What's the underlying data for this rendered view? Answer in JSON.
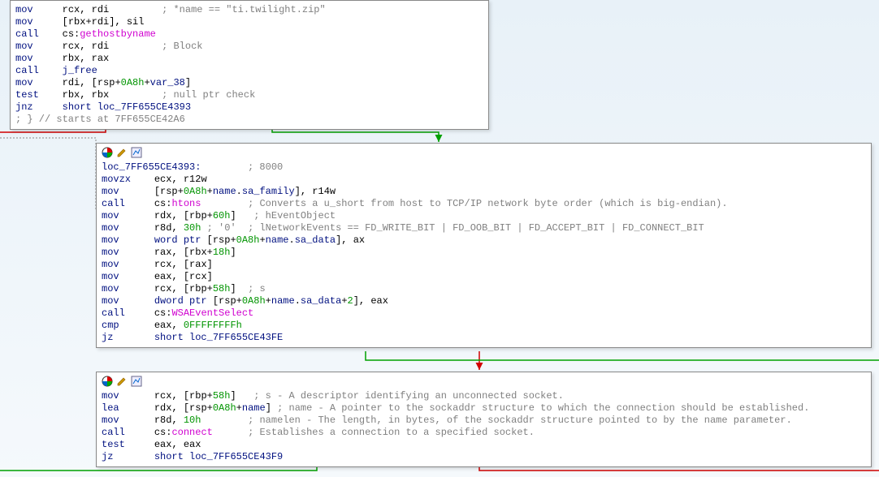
{
  "box1": {
    "lines": [
      {
        "p": [
          [
            "mnem",
            "mov   "
          ],
          [
            "reg",
            "  rcx"
          ],
          [
            "dot",
            ", "
          ],
          [
            "reg",
            "rdi         "
          ],
          [
            "comment",
            "; *name == \"ti.twilight.zip\""
          ]
        ]
      },
      {
        "p": [
          [
            "mnem",
            "mov   "
          ],
          [
            "dot",
            "  ["
          ],
          [
            "reg",
            "rbx"
          ],
          [
            "dot",
            "+"
          ],
          [
            "reg",
            "rdi"
          ],
          [
            "dot",
            "], "
          ],
          [
            "reg",
            "sil"
          ]
        ]
      },
      {
        "p": [
          [
            "mnem",
            "call  "
          ],
          [
            "dot",
            "  cs:"
          ],
          [
            "apicall",
            "gethostbyname"
          ]
        ]
      },
      {
        "p": [
          [
            "mnem",
            "mov   "
          ],
          [
            "reg",
            "  rcx"
          ],
          [
            "dot",
            ", "
          ],
          [
            "reg",
            "rdi         "
          ],
          [
            "comment",
            "; Block"
          ]
        ]
      },
      {
        "p": [
          [
            "mnem",
            "mov   "
          ],
          [
            "reg",
            "  rbx"
          ],
          [
            "dot",
            ", "
          ],
          [
            "reg",
            "rax"
          ]
        ]
      },
      {
        "p": [
          [
            "mnem",
            "call  "
          ],
          [
            "sym",
            "  j_free"
          ]
        ]
      },
      {
        "p": [
          [
            "mnem",
            "mov   "
          ],
          [
            "reg",
            "  rdi"
          ],
          [
            "dot",
            ", ["
          ],
          [
            "reg",
            "rsp"
          ],
          [
            "dot",
            "+"
          ],
          [
            "num",
            "0A8h"
          ],
          [
            "dot",
            "+"
          ],
          [
            "sym",
            "var_38"
          ],
          [
            "dot",
            "]"
          ]
        ]
      },
      {
        "p": [
          [
            "mnem",
            "test  "
          ],
          [
            "reg",
            "  rbx"
          ],
          [
            "dot",
            ", "
          ],
          [
            "reg",
            "rbx         "
          ],
          [
            "comment",
            "; null ptr check"
          ]
        ]
      },
      {
        "p": [
          [
            "mnem",
            "jnz   "
          ],
          [
            "keyword",
            "  short "
          ],
          [
            "sym",
            "loc_7FF655CE4393"
          ]
        ]
      },
      {
        "p": [
          [
            "comment",
            "; } // starts at 7FF655CE42A6"
          ]
        ]
      }
    ]
  },
  "box2": {
    "loc_label": "loc_7FF655CE4393:",
    "loc_comment": "; 8000",
    "lines": [
      {
        "p": [
          [
            "mnem",
            "movzx  "
          ],
          [
            "reg",
            "  ecx"
          ],
          [
            "dot",
            ", "
          ],
          [
            "reg",
            "r12w"
          ]
        ]
      },
      {
        "p": [
          [
            "mnem",
            "mov    "
          ],
          [
            "dot",
            "  ["
          ],
          [
            "reg",
            "rsp"
          ],
          [
            "dot",
            "+"
          ],
          [
            "num",
            "0A8h"
          ],
          [
            "dot",
            "+"
          ],
          [
            "sym",
            "name"
          ],
          [
            "dot",
            "."
          ],
          [
            "sym",
            "sa_family"
          ],
          [
            "dot",
            "], "
          ],
          [
            "reg",
            "r14w"
          ]
        ]
      },
      {
        "p": [
          [
            "mnem",
            "call   "
          ],
          [
            "dot",
            "  cs:"
          ],
          [
            "apicall",
            "htons"
          ],
          [
            "dot",
            "        "
          ],
          [
            "comment",
            "; Converts a u_short from host to TCP/IP network byte order (which is big-endian)."
          ]
        ]
      },
      {
        "p": [
          [
            "mnem",
            "mov    "
          ],
          [
            "reg",
            "  rdx"
          ],
          [
            "dot",
            ", ["
          ],
          [
            "reg",
            "rbp"
          ],
          [
            "dot",
            "+"
          ],
          [
            "num",
            "60h"
          ],
          [
            "dot",
            "]   "
          ],
          [
            "comment",
            "; hEventObject"
          ]
        ]
      },
      {
        "p": [
          [
            "mnem",
            "mov    "
          ],
          [
            "reg",
            "  r8d"
          ],
          [
            "dot",
            ", "
          ],
          [
            "num",
            "30h"
          ],
          [
            "comment",
            " ; '0'  ; lNetworkEvents == FD_WRITE_BIT | FD_OOB_BIT | FD_ACCEPT_BIT | FD_CONNECT_BIT"
          ]
        ]
      },
      {
        "p": [
          [
            "mnem",
            "mov    "
          ],
          [
            "keyword",
            "  word ptr "
          ],
          [
            "dot",
            "["
          ],
          [
            "reg",
            "rsp"
          ],
          [
            "dot",
            "+"
          ],
          [
            "num",
            "0A8h"
          ],
          [
            "dot",
            "+"
          ],
          [
            "sym",
            "name"
          ],
          [
            "dot",
            "."
          ],
          [
            "sym",
            "sa_data"
          ],
          [
            "dot",
            "], "
          ],
          [
            "reg",
            "ax"
          ]
        ]
      },
      {
        "p": [
          [
            "mnem",
            "mov    "
          ],
          [
            "reg",
            "  rax"
          ],
          [
            "dot",
            ", ["
          ],
          [
            "reg",
            "rbx"
          ],
          [
            "dot",
            "+"
          ],
          [
            "num",
            "18h"
          ],
          [
            "dot",
            "]"
          ]
        ]
      },
      {
        "p": [
          [
            "mnem",
            "mov    "
          ],
          [
            "reg",
            "  rcx"
          ],
          [
            "dot",
            ", ["
          ],
          [
            "reg",
            "rax"
          ],
          [
            "dot",
            "]"
          ]
        ]
      },
      {
        "p": [
          [
            "mnem",
            "mov    "
          ],
          [
            "reg",
            "  eax"
          ],
          [
            "dot",
            ", ["
          ],
          [
            "reg",
            "rcx"
          ],
          [
            "dot",
            "]"
          ]
        ]
      },
      {
        "p": [
          [
            "mnem",
            "mov    "
          ],
          [
            "reg",
            "  rcx"
          ],
          [
            "dot",
            ", ["
          ],
          [
            "reg",
            "rbp"
          ],
          [
            "dot",
            "+"
          ],
          [
            "num",
            "58h"
          ],
          [
            "dot",
            "]  "
          ],
          [
            "comment",
            "; s"
          ]
        ]
      },
      {
        "p": [
          [
            "mnem",
            "mov    "
          ],
          [
            "keyword",
            "  dword ptr "
          ],
          [
            "dot",
            "["
          ],
          [
            "reg",
            "rsp"
          ],
          [
            "dot",
            "+"
          ],
          [
            "num",
            "0A8h"
          ],
          [
            "dot",
            "+"
          ],
          [
            "sym",
            "name"
          ],
          [
            "dot",
            "."
          ],
          [
            "sym",
            "sa_data"
          ],
          [
            "dot",
            "+"
          ],
          [
            "num",
            "2"
          ],
          [
            "dot",
            "], "
          ],
          [
            "reg",
            "eax"
          ]
        ]
      },
      {
        "p": [
          [
            "mnem",
            "call   "
          ],
          [
            "dot",
            "  cs:"
          ],
          [
            "apicall",
            "WSAEventSelect"
          ]
        ]
      },
      {
        "p": [
          [
            "mnem",
            "cmp    "
          ],
          [
            "reg",
            "  eax"
          ],
          [
            "dot",
            ", "
          ],
          [
            "num",
            "0FFFFFFFFh"
          ]
        ]
      },
      {
        "p": [
          [
            "mnem",
            "jz     "
          ],
          [
            "keyword",
            "  short "
          ],
          [
            "sym",
            "loc_7FF655CE43FE"
          ]
        ]
      }
    ]
  },
  "box3": {
    "lines": [
      {
        "p": [
          [
            "mnem",
            "mov    "
          ],
          [
            "reg",
            "  rcx"
          ],
          [
            "dot",
            ", ["
          ],
          [
            "reg",
            "rbp"
          ],
          [
            "dot",
            "+"
          ],
          [
            "num",
            "58h"
          ],
          [
            "dot",
            "]   "
          ],
          [
            "comment",
            "; s - A descriptor identifying an unconnected socket."
          ]
        ]
      },
      {
        "p": [
          [
            "mnem",
            "lea    "
          ],
          [
            "reg",
            "  rdx"
          ],
          [
            "dot",
            ", ["
          ],
          [
            "reg",
            "rsp"
          ],
          [
            "dot",
            "+"
          ],
          [
            "num",
            "0A8h"
          ],
          [
            "dot",
            "+"
          ],
          [
            "sym",
            "name"
          ],
          [
            "dot",
            "] "
          ],
          [
            "comment",
            "; name - A pointer to the sockaddr structure to which the connection should be established."
          ]
        ]
      },
      {
        "p": [
          [
            "mnem",
            "mov    "
          ],
          [
            "reg",
            "  r8d"
          ],
          [
            "dot",
            ", "
          ],
          [
            "num",
            "10h"
          ],
          [
            "dot",
            "        "
          ],
          [
            "comment",
            "; namelen - The length, in bytes, of the sockaddr structure pointed to by the name parameter."
          ]
        ]
      },
      {
        "p": [
          [
            "mnem",
            "call   "
          ],
          [
            "dot",
            "  cs:"
          ],
          [
            "apicall",
            "connect"
          ],
          [
            "dot",
            "      "
          ],
          [
            "comment",
            "; Establishes a connection to a specified socket."
          ]
        ]
      },
      {
        "p": [
          [
            "mnem",
            "test   "
          ],
          [
            "reg",
            "  eax"
          ],
          [
            "dot",
            ", "
          ],
          [
            "reg",
            "eax"
          ]
        ]
      },
      {
        "p": [
          [
            "mnem",
            "jz     "
          ],
          [
            "keyword",
            "  short "
          ],
          [
            "sym",
            "loc_7FF655CE43F9"
          ]
        ]
      }
    ]
  }
}
